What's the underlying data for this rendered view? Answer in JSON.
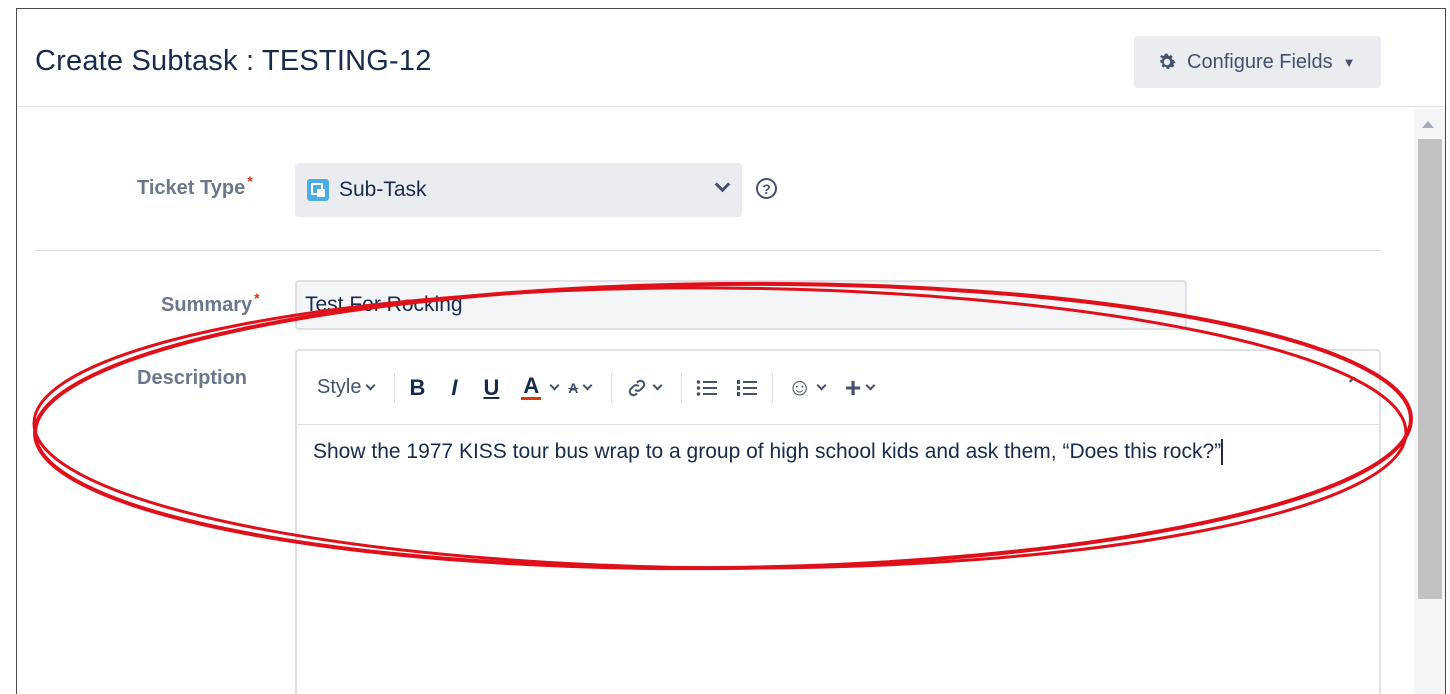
{
  "header": {
    "title": "Create Subtask : TESTING-12",
    "configure_fields_label": "Configure Fields"
  },
  "fields": {
    "ticket_type": {
      "label": "Ticket Type",
      "required_marker": "*",
      "value": "Sub-Task",
      "help": "?"
    },
    "summary": {
      "label": "Summary",
      "required_marker": "*",
      "value": "Test For Rocking"
    },
    "description": {
      "label": "Description",
      "toolbar": {
        "style": "Style",
        "bold": "B",
        "italic": "I",
        "underline": "U",
        "text_color": "A",
        "text_formatting": "A",
        "list_bullets": "☰",
        "list_numbers": "☷",
        "emoji": "☺",
        "insert": "+",
        "collapse": "⌃"
      },
      "content": "Show the 1977 KISS tour bus wrap to a group of high school kids and ask them, “Does this rock?”"
    }
  },
  "colors": {
    "required": "#de350b",
    "annotation": "#e0101a",
    "subtask_icon": "#4bade8"
  },
  "icons": [
    "gear-icon",
    "caret-down-icon",
    "subtask-icon",
    "chevron-down-icon",
    "help-icon",
    "link-icon",
    "bullet-list-icon",
    "numbered-list-icon",
    "emoji-icon",
    "plus-icon",
    "collapse-icon"
  ]
}
